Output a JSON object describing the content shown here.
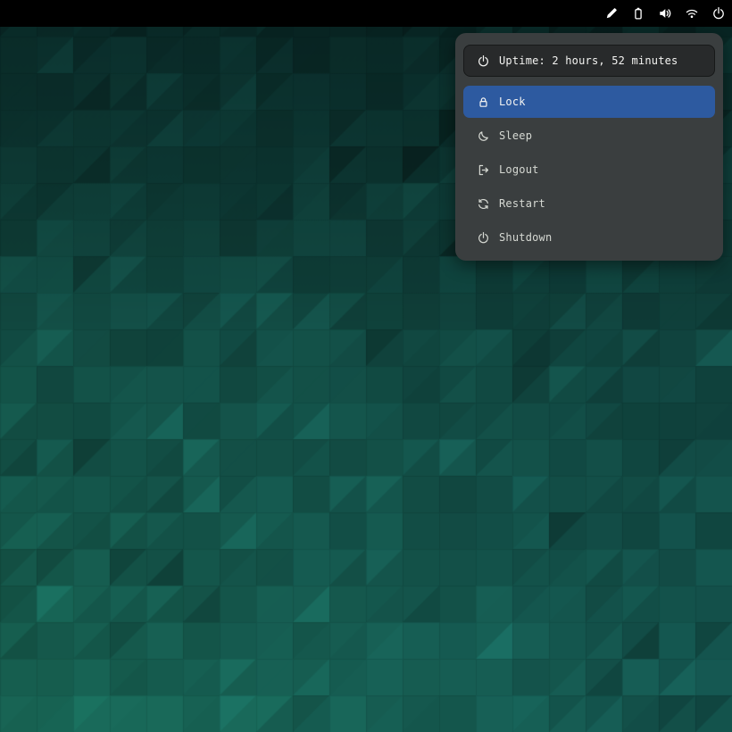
{
  "topbar": {
    "icons": [
      {
        "name": "edit"
      },
      {
        "name": "battery"
      },
      {
        "name": "volume"
      },
      {
        "name": "wifi"
      },
      {
        "name": "power"
      }
    ]
  },
  "power_menu": {
    "uptime": {
      "icon": "power",
      "label": "Uptime: 2 hours, 52 minutes"
    },
    "items": [
      {
        "icon": "lock",
        "label": "Lock",
        "selected": true
      },
      {
        "icon": "moon",
        "label": "Sleep",
        "selected": false
      },
      {
        "icon": "logout",
        "label": "Logout",
        "selected": false
      },
      {
        "icon": "restart",
        "label": "Restart",
        "selected": false
      },
      {
        "icon": "power",
        "label": "Shutdown",
        "selected": false
      }
    ]
  },
  "colors": {
    "bar_bg": "#000000",
    "bar_icon": "#ffffff",
    "menu_bg": "#3a3e3f",
    "pill_bg": "#282a2b",
    "pill_border": "#171919",
    "accent": "#2d5aa0",
    "text_bright": "#f4f4f2",
    "text_normal": "#d6d9d3",
    "wallpaper_hue": "174",
    "wallpaper_sat": "0.62"
  }
}
